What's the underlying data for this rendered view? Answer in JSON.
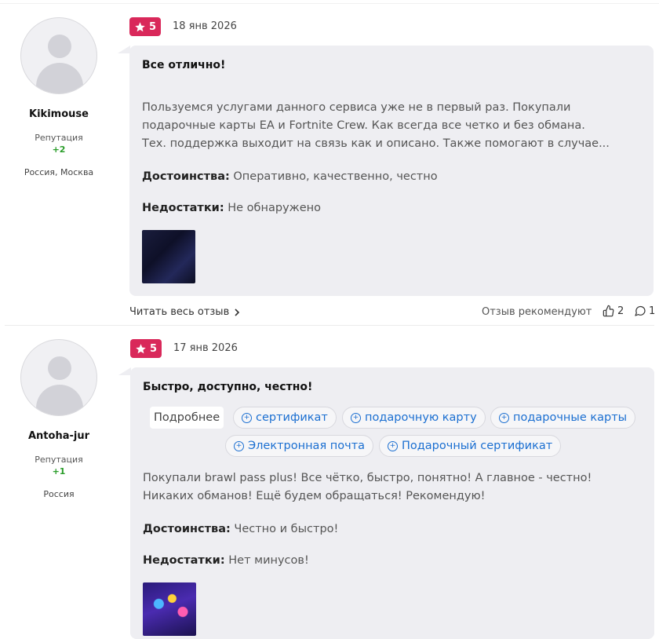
{
  "reviews": [
    {
      "author": "Kikimouse",
      "reputation_label": "Репутация",
      "reputation": "+2",
      "location": "Россия, Москва",
      "rating": "5",
      "date": "18 янв 2026",
      "title": "Все отлично!",
      "text": "Пользуемся услугами данного сервиса уже не в первый раз. Покупали подарочные карты EA и Fortnite Crew. Как всегда все четко и без обмана. Тех. поддержка выходит на связь как и описано. Также помогают в случае...",
      "pros_label": "Достоинства:",
      "pros": "Оперативно, качественно, честно",
      "cons_label": "Недостатки:",
      "cons": "Не обнаружено",
      "read_more": "Читать весь отзыв",
      "recommend_label": "Отзыв рекомендуют",
      "likes": "2",
      "comments": "1"
    },
    {
      "author": "Antoha-jur",
      "reputation_label": "Репутация",
      "reputation": "+1",
      "location": "Россия",
      "rating": "5",
      "date": "17 янв 2026",
      "title": "Быстро, доступно, честно!",
      "details_label": "Подробнее",
      "tags": [
        "сертификат",
        "подарочную карту",
        "подарочные карты",
        "Электронная почта",
        "Подарочный сертификат"
      ],
      "text": "Покупали brawl pass plus! Все чётко, быстро, понятно! А главное - честно! Никаких обманов! Ещё будем обращаться! Рекомендую!",
      "pros_label": "Достоинства:",
      "pros": "Честно и быстро!",
      "cons_label": "Недостатки:",
      "cons": "Нет минусов!"
    }
  ],
  "colors": {
    "rating_bg": "#d9285a",
    "tag_text": "#1b6fd1",
    "reputation": "#2a9d2a",
    "card_bg": "#eeeef2"
  }
}
